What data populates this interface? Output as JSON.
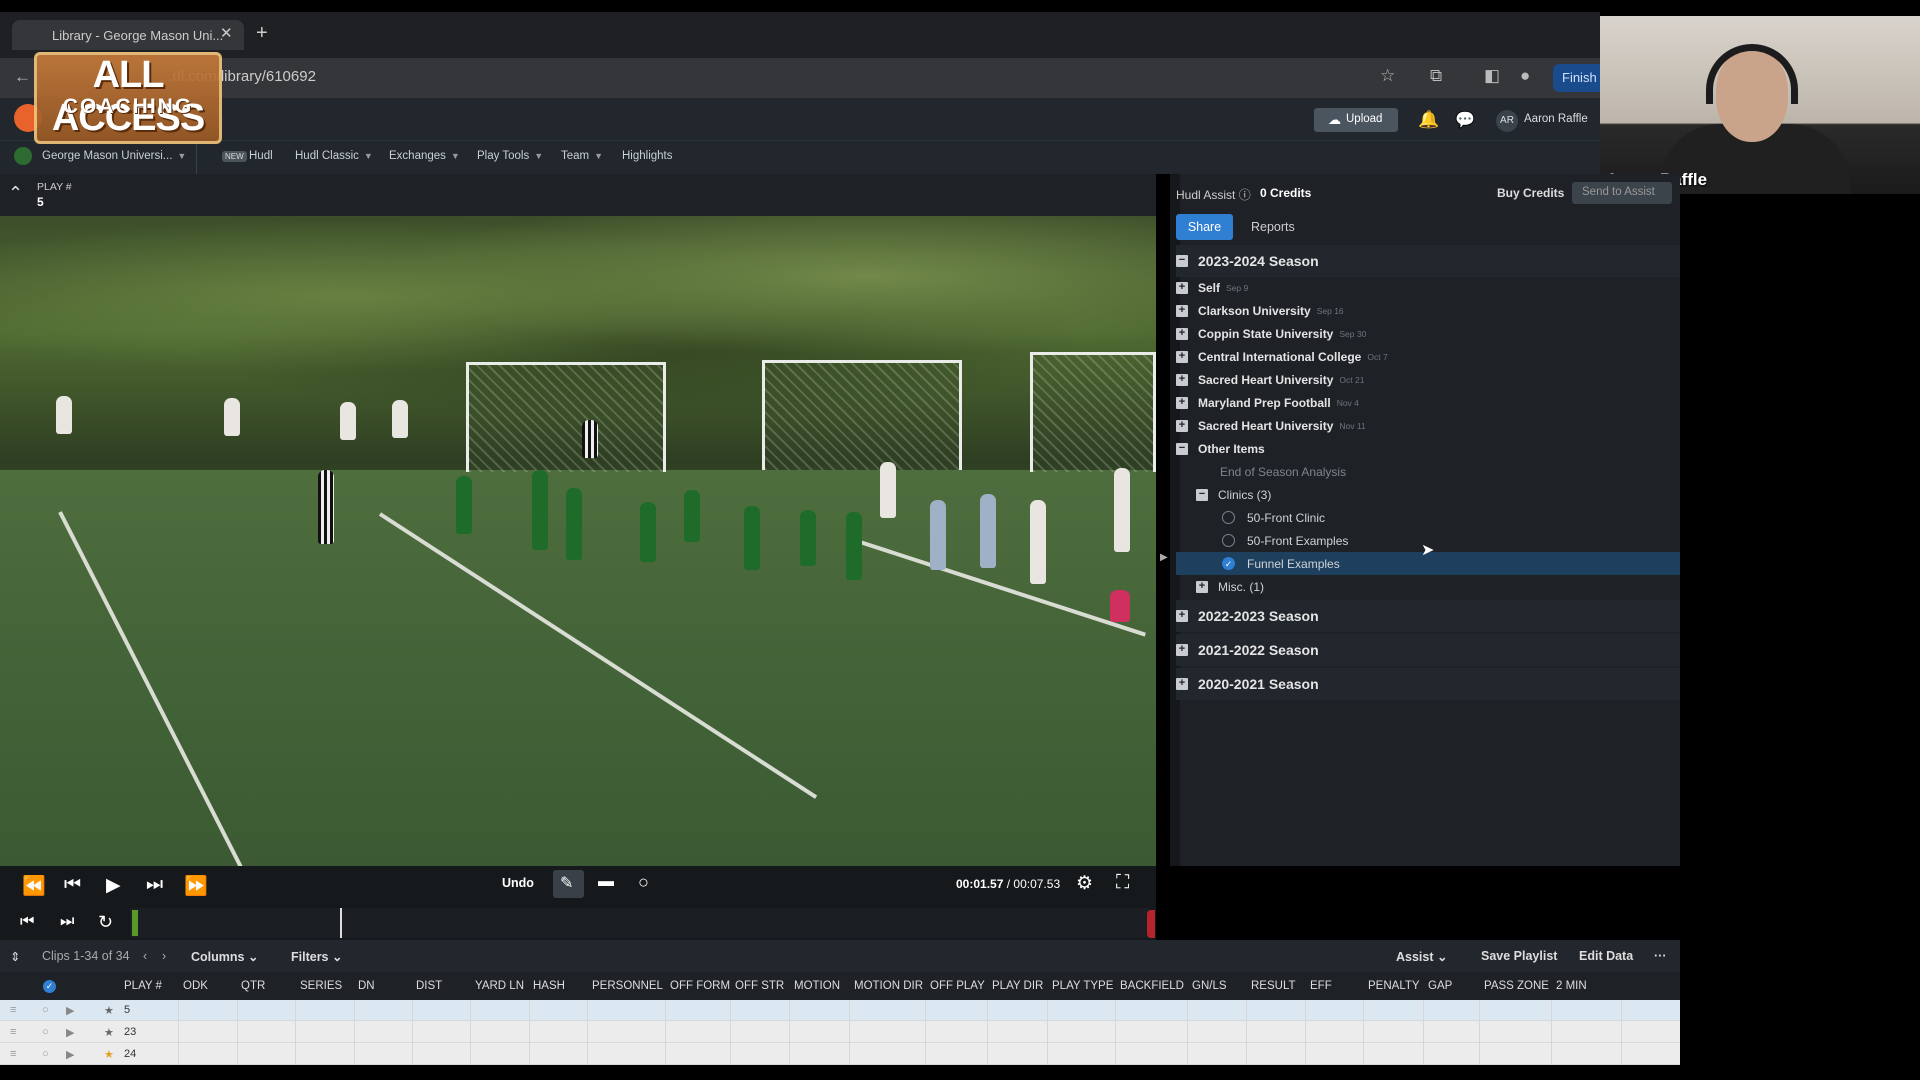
{
  "browser": {
    "tab_title": "Library - George Mason Uni...",
    "url": "...dl.com/library/610692",
    "finish_label": "Finish"
  },
  "logo": {
    "line1": "ALL ACCESS",
    "line2": "COACHING"
  },
  "webcam": {
    "name": "Aaron Raffle"
  },
  "hudl": {
    "team": "George Mason Universi...",
    "nav": [
      "Hudl",
      "Hudl Classic",
      "Exchanges",
      "Play Tools",
      "Team",
      "Highlights"
    ],
    "new_badge": "NEW",
    "upload": "Upload",
    "avatar_initials": "AR",
    "user": "Aaron Raffle"
  },
  "video": {
    "play_label": "PLAY #",
    "play_value": "5",
    "undo": "Undo",
    "timecode_current": "00:01.57",
    "timecode_separator": "/",
    "timecode_total": "00:07.53"
  },
  "panel": {
    "assist_label": "Hudl Assist",
    "credits": "0 Credits",
    "buy_credits": "Buy Credits",
    "send_button": "Send to Assist",
    "tabs": [
      "Share",
      "Reports"
    ],
    "season_2023": "2023-2024 Season",
    "games": [
      {
        "name": "Self",
        "date": "Sep 9"
      },
      {
        "name": "Clarkson University",
        "date": "Sep 16"
      },
      {
        "name": "Coppin State University",
        "date": "Sep 30"
      },
      {
        "name": "Central International College",
        "date": "Oct 7"
      },
      {
        "name": "Sacred Heart University",
        "date": "Oct 21"
      },
      {
        "name": "Maryland Prep Football",
        "date": "Nov 4"
      },
      {
        "name": "Sacred Heart University",
        "date": "Nov 11"
      }
    ],
    "other_items": "Other Items",
    "end_of_season": "End of Season Analysis",
    "clinics": "Clinics (3)",
    "clinic_items": [
      "50-Front Clinic",
      "50-Front Examples",
      "Funnel Examples"
    ],
    "misc": "Misc. (1)",
    "seasons_collapsed": [
      "2022-2023 Season",
      "2021-2022 Season",
      "2020-2021 Season"
    ]
  },
  "table": {
    "clips": "Clips 1-34 of 34",
    "columns": "Columns",
    "filters": "Filters",
    "assist": "Assist",
    "save_playlist": "Save Playlist",
    "edit_data": "Edit Data",
    "headers": [
      "PLAY #",
      "ODK",
      "QTR",
      "SERIES",
      "DN",
      "DIST",
      "YARD LN",
      "HASH",
      "PERSONNEL",
      "OFF FORM",
      "OFF STR",
      "MOTION",
      "MOTION DIR",
      "OFF PLAY",
      "PLAY DIR",
      "PLAY TYPE",
      "BACKFIELD",
      "GN/LS",
      "RESULT",
      "EFF",
      "PENALTY",
      "GAP",
      "PASS ZONE",
      "2 MIN"
    ],
    "rows": [
      {
        "play": "5",
        "star_color": "#666"
      },
      {
        "play": "23",
        "star_color": "#666"
      },
      {
        "play": "24",
        "star_color": "#e0a020"
      }
    ]
  }
}
